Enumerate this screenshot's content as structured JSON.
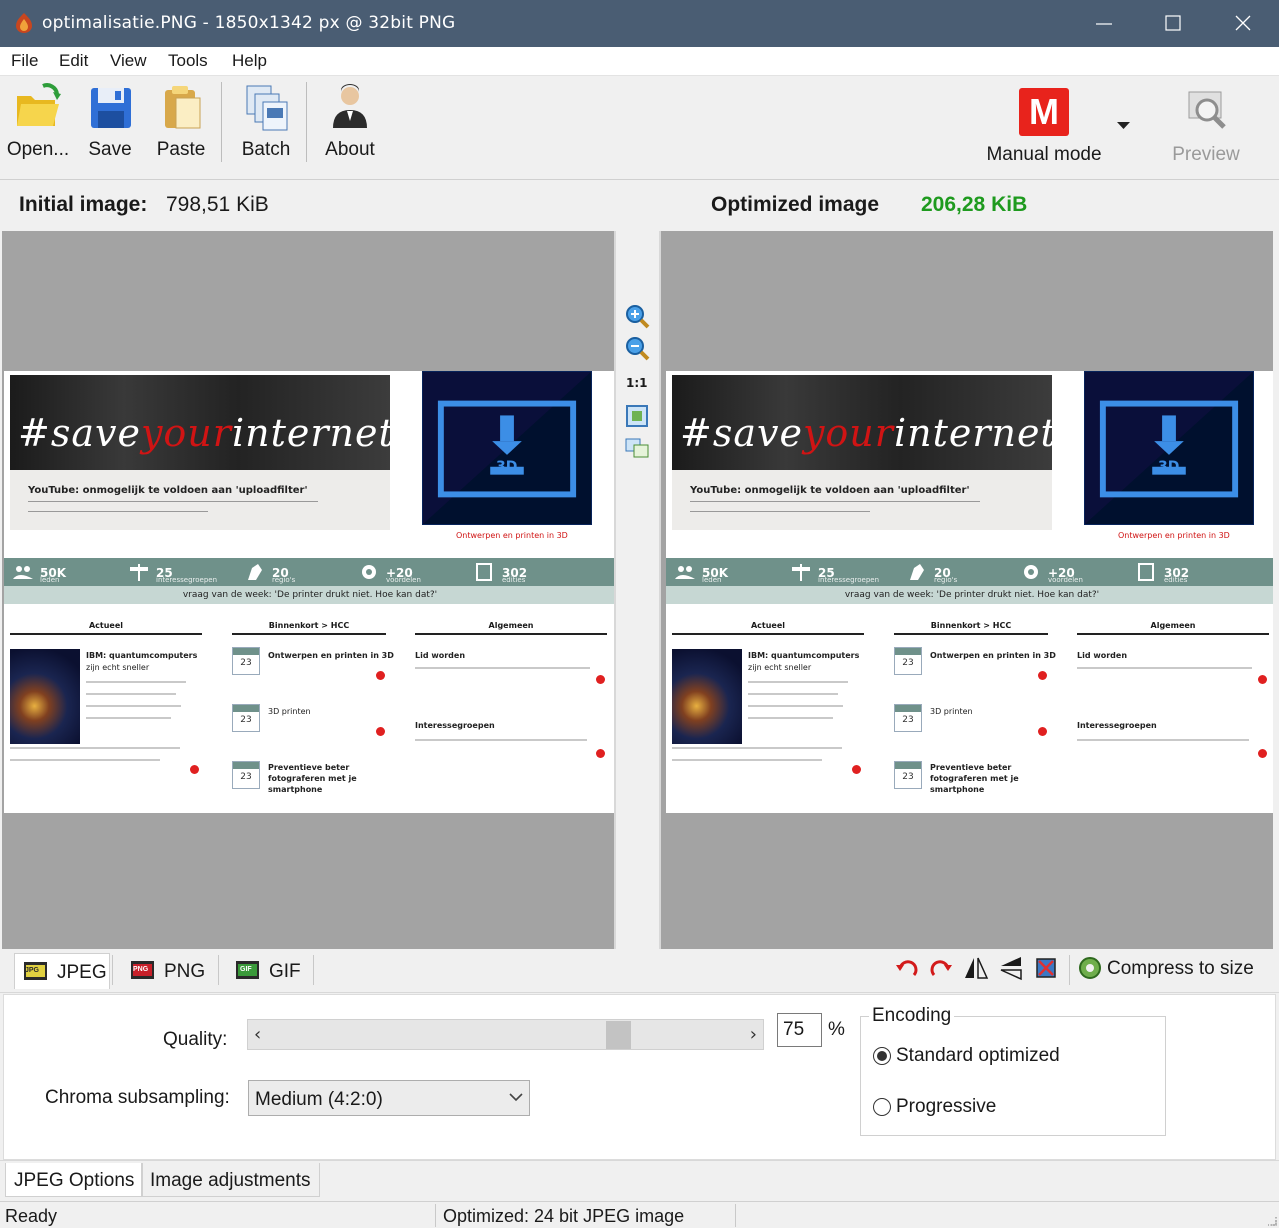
{
  "window": {
    "title": "optimalisatie.PNG - 1850x1342 px @ 32bit PNG"
  },
  "menu": [
    "File",
    "Edit",
    "View",
    "Tools",
    "Help"
  ],
  "toolbar": {
    "open": "Open...",
    "save": "Save",
    "paste": "Paste",
    "batch": "Batch",
    "about": "About",
    "mode_letter": "M",
    "mode": "Manual mode",
    "preview": "Preview"
  },
  "sizes": {
    "initial_label": "Initial image:",
    "initial_value": "798,51 KiB",
    "optimized_label": "Optimized image",
    "optimized_value": "206,28 KiB"
  },
  "zoom": {
    "one_to_one": "1:1"
  },
  "preview_site": {
    "hero_hash": "#save",
    "hero_your": "your",
    "hero_internet": "internet",
    "hero_headline": "YouTube: onmogelijk te voldoen aan 'uploadfilter'",
    "side_caption": "Ontwerpen en printen in 3D",
    "badge_3d": "3D",
    "stats": [
      {
        "n": "50K",
        "u": "leden"
      },
      {
        "n": "25",
        "u": "interessegroepen"
      },
      {
        "n": "20",
        "u": "regio's"
      },
      {
        "n": "+20",
        "u": "voordelen"
      },
      {
        "n": "302",
        "u": "edities"
      }
    ],
    "question": "vraag van de week: 'De printer drukt niet. Hoe kan dat?'",
    "columns": [
      "Actueel",
      "Binnenkort > HCC",
      "Algemeen"
    ],
    "col1_title": "IBM: quantumcomputers",
    "col1_title2": "zijn echt sneller",
    "col2_items": [
      "Ontwerpen en printen in 3D",
      "3D printen",
      "Preventieve beter",
      "fotograferen met je",
      "smartphone"
    ],
    "col3_items": [
      "Lid worden",
      "Interessegroepen"
    ],
    "cal_day": "23"
  },
  "formats": [
    "JPEG",
    "PNG",
    "GIF"
  ],
  "format_icon_labels": [
    "JPG",
    "PNG",
    "GIF"
  ],
  "compress": "Compress to size",
  "options": {
    "quality_label": "Quality:",
    "quality_value": "75",
    "quality_fraction": 0.75,
    "percent": "%",
    "chroma_label": "Chroma subsampling:",
    "chroma_value": "Medium (4:2:0)",
    "encoding_label": "Encoding",
    "standard": "Standard optimized",
    "progressive": "Progressive"
  },
  "bottom_tabs": [
    "JPEG Options",
    "Image adjustments"
  ],
  "status": {
    "ready": "Ready",
    "info": "Optimized: 24 bit JPEG image"
  }
}
